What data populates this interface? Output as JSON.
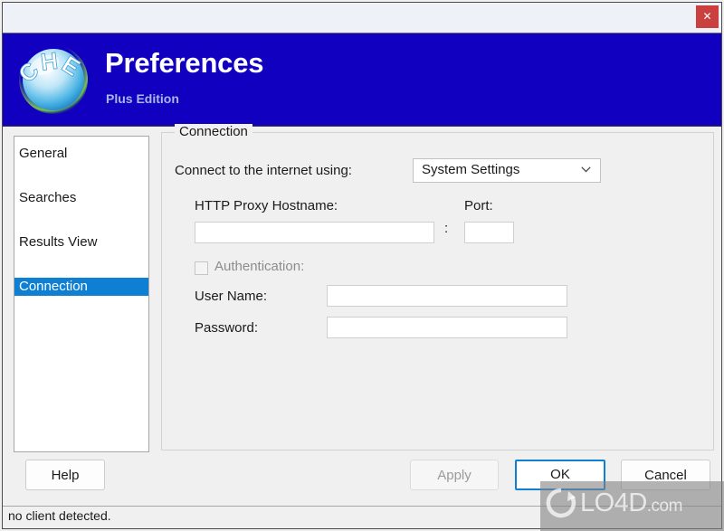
{
  "window": {
    "close_label": "✕"
  },
  "banner": {
    "title": "Preferences",
    "subtitle": "Plus Edition",
    "logo_text": "CHE",
    "bg_color": "#1200c0",
    "title_color": "#ffffff",
    "subtitle_color": "#a9b7e8"
  },
  "sidebar": {
    "items": [
      {
        "label": "General",
        "selected": false
      },
      {
        "label": "Searches",
        "selected": false
      },
      {
        "label": "Results View",
        "selected": false
      },
      {
        "label": "Connection",
        "selected": true
      }
    ],
    "selected_color": "#0f7fd4"
  },
  "main": {
    "group_title": "Connection",
    "connect_label": "Connect to the internet using:",
    "connect_select": {
      "value": "System Settings",
      "options": [
        "System Settings"
      ]
    },
    "proxy_host_label": "HTTP Proxy Hostname:",
    "proxy_host_value": "",
    "colon": ":",
    "port_label": "Port:",
    "port_value": "",
    "auth_label": "Authentication:",
    "auth_checked": false,
    "auth_enabled": false,
    "username_label": "User Name:",
    "username_value": "",
    "password_label": "Password:",
    "password_value": ""
  },
  "buttons": {
    "help": "Help",
    "apply": "Apply",
    "ok": "OK",
    "cancel": "Cancel",
    "apply_enabled": false,
    "ok_is_default": true
  },
  "statusbar": {
    "text": "no client detected."
  },
  "watermark": {
    "name": "LO4D",
    "suffix": ".com"
  }
}
